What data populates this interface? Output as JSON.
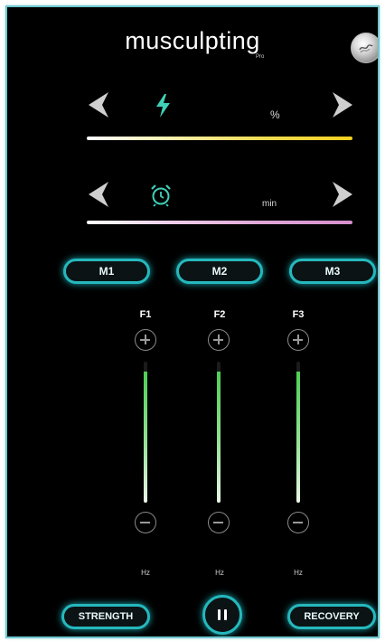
{
  "header": {
    "brand": "musculpting",
    "brand_sub": "Pro",
    "profile_icon": "profile-disc-icon"
  },
  "power": {
    "icon": "lightning-icon",
    "icon_color": "#3fd0b8",
    "unit": "%",
    "value": "",
    "decrease_icon": "chevron-left-icon",
    "increase_icon": "chevron-right-icon",
    "track_colors": [
      "#ffffff",
      "#f5d020"
    ]
  },
  "timer": {
    "icon": "alarm-clock-icon",
    "icon_color": "#3fd0b8",
    "unit": "min",
    "value": "",
    "decrease_icon": "chevron-left-icon",
    "increase_icon": "chevron-right-icon",
    "track_colors": [
      "#ffffff",
      "#d58fce"
    ]
  },
  "modes": [
    {
      "label": "M1"
    },
    {
      "label": "M2"
    },
    {
      "label": "M3"
    }
  ],
  "channels": [
    {
      "label": "F1",
      "unit": "Hz",
      "level": 0.93
    },
    {
      "label": "F2",
      "unit": "Hz",
      "level": 0.93
    },
    {
      "label": "F3",
      "unit": "Hz",
      "level": 0.93
    }
  ],
  "footer": {
    "strength_label": "STRENGTH",
    "recovery_label": "RECOVERY",
    "pause_icon": "pause-icon"
  },
  "colors": {
    "accent": "#25b8bd",
    "frame": "#6fc7cf",
    "slider_fill": "#4ccf54",
    "background": "#000000"
  }
}
